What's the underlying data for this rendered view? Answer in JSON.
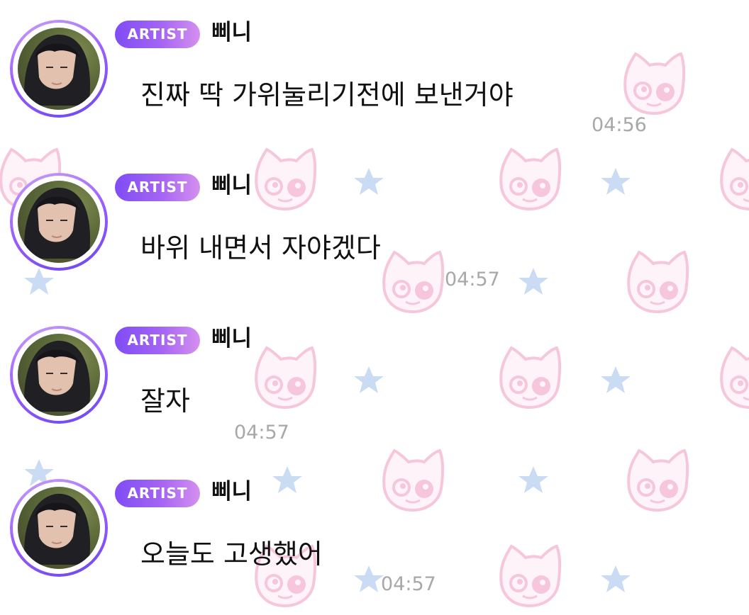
{
  "chat": {
    "messages": [
      {
        "badge": "ARTIST",
        "sender": "삐니",
        "text": "진짜 딱 가위눌리기전에 보낸거야",
        "time": "04:56"
      },
      {
        "badge": "ARTIST",
        "sender": "삐니",
        "text": "바위 내면서 자야겠다",
        "time": "04:57"
      },
      {
        "badge": "ARTIST",
        "sender": "삐니",
        "text": "잘자",
        "time": "04:57"
      },
      {
        "badge": "ARTIST",
        "sender": "삐니",
        "text": "오늘도 고생했어",
        "time": "04:57"
      }
    ]
  },
  "theme": {
    "badge_gradient_start": "#7f4cf5",
    "badge_gradient_end": "#d590ee",
    "pattern_cat_color": "#f6c6dc",
    "pattern_star_color": "#c9dcf4",
    "timestamp_color": "#a8a8a8",
    "background_pattern_icons": [
      "cat-face-icon",
      "star-icon"
    ]
  }
}
